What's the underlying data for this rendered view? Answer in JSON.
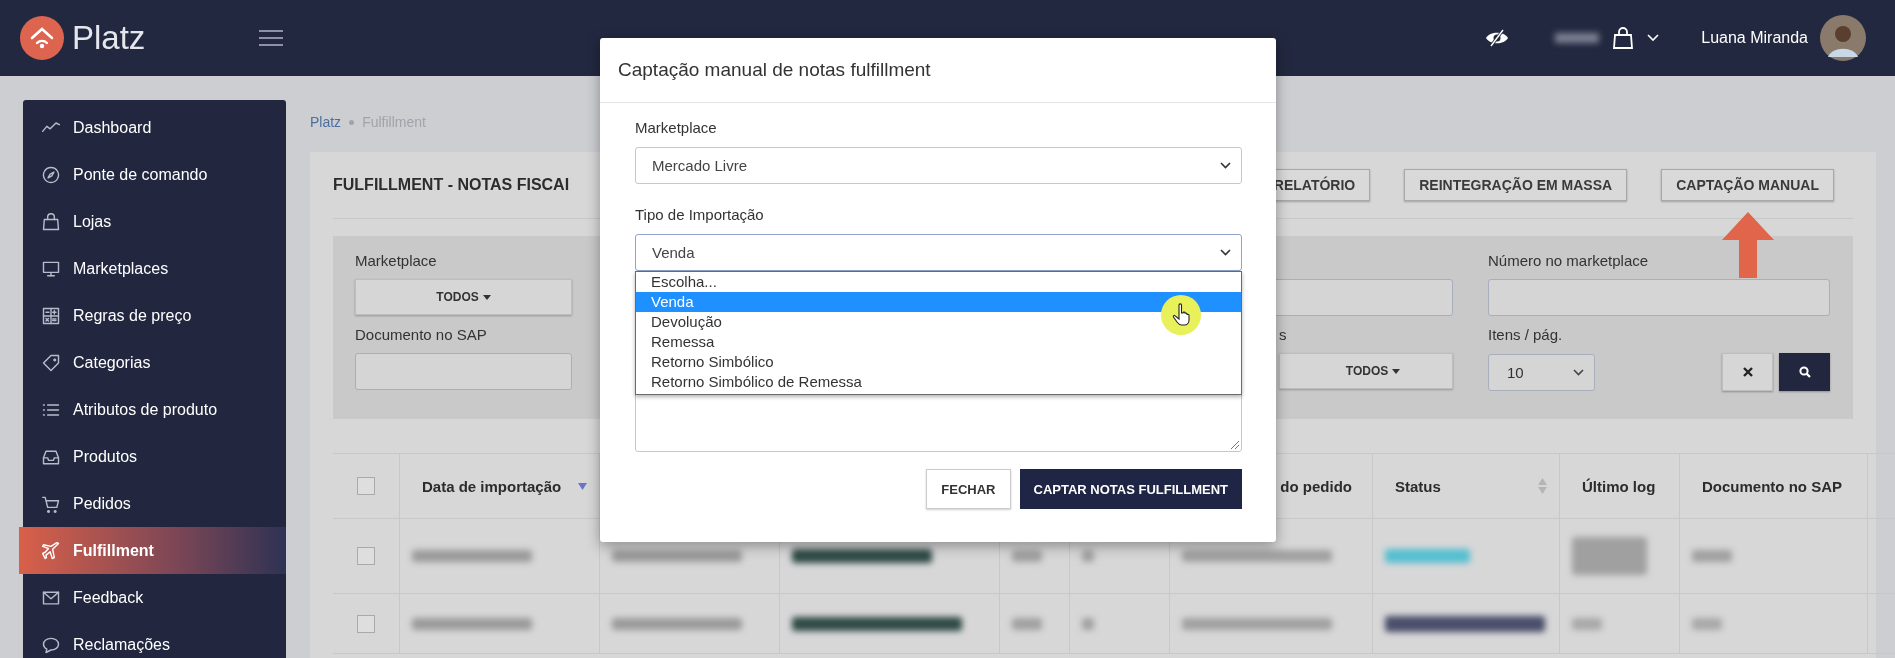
{
  "topbar": {
    "brand": "Platz",
    "user_name": "Luana Miranda"
  },
  "sidebar": {
    "items": [
      {
        "label": "Dashboard",
        "selected": false
      },
      {
        "label": "Ponte de comando",
        "selected": false
      },
      {
        "label": "Lojas",
        "selected": false
      },
      {
        "label": "Marketplaces",
        "selected": false
      },
      {
        "label": "Regras de preço",
        "selected": false
      },
      {
        "label": "Categorias",
        "selected": false
      },
      {
        "label": "Atributos de produto",
        "selected": false
      },
      {
        "label": "Produtos",
        "selected": false
      },
      {
        "label": "Pedidos",
        "selected": false
      },
      {
        "label": "Fulfillment",
        "selected": true
      },
      {
        "label": "Feedback",
        "selected": false
      },
      {
        "label": "Reclamações",
        "selected": false
      }
    ]
  },
  "breadcrumb": [
    "Platz",
    "Fulfillment"
  ],
  "page": {
    "title": "FULFILLMENT - NOTAS FISCAI",
    "actions": [
      "RELATÓRIO",
      "REINTEGRAÇÃO EM MASSA",
      "CAPTAÇÃO MANUAL"
    ]
  },
  "filters": {
    "marketplace": {
      "label": "Marketplace",
      "value": "TODOS"
    },
    "numero_marketplace": {
      "label": "Número no marketplace"
    },
    "documento_sap": {
      "label": "Documento no SAP"
    },
    "status": {
      "label": "s",
      "value": "TODOS"
    },
    "itens_por_pagina": {
      "label": "Itens / pág.",
      "value": "10"
    }
  },
  "table": {
    "header_checked": false,
    "columns": [
      {
        "label": "Data de importação",
        "sorted_descending": true
      },
      {
        "label": "do pedido"
      },
      {
        "label": "Status",
        "sortable": true
      },
      {
        "label": "Último log"
      },
      {
        "label": "Documento no SAP"
      }
    ],
    "rows": [
      {
        "checked": false
      },
      {
        "checked": false
      }
    ]
  },
  "modal": {
    "title": "Captação manual de notas fulfillment",
    "fields": [
      {
        "label": "Marketplace",
        "value": "Mercado Livre"
      },
      {
        "label": "Tipo de Importação",
        "value": "Venda"
      }
    ],
    "dropdown_options": [
      {
        "label": "Escolha...",
        "selected": false
      },
      {
        "label": "Venda",
        "selected": true
      },
      {
        "label": "Devolução",
        "selected": false
      },
      {
        "label": "Remessa",
        "selected": false
      },
      {
        "label": "Retorno Simbólico",
        "selected": false
      },
      {
        "label": "Retorno Simbólico de Remessa",
        "selected": false
      }
    ],
    "buttons": [
      {
        "label": "FECHAR",
        "kind": "secondary"
      },
      {
        "label": "CAPTAR NOTAS FULFILLMENT",
        "kind": "primary"
      }
    ]
  }
}
